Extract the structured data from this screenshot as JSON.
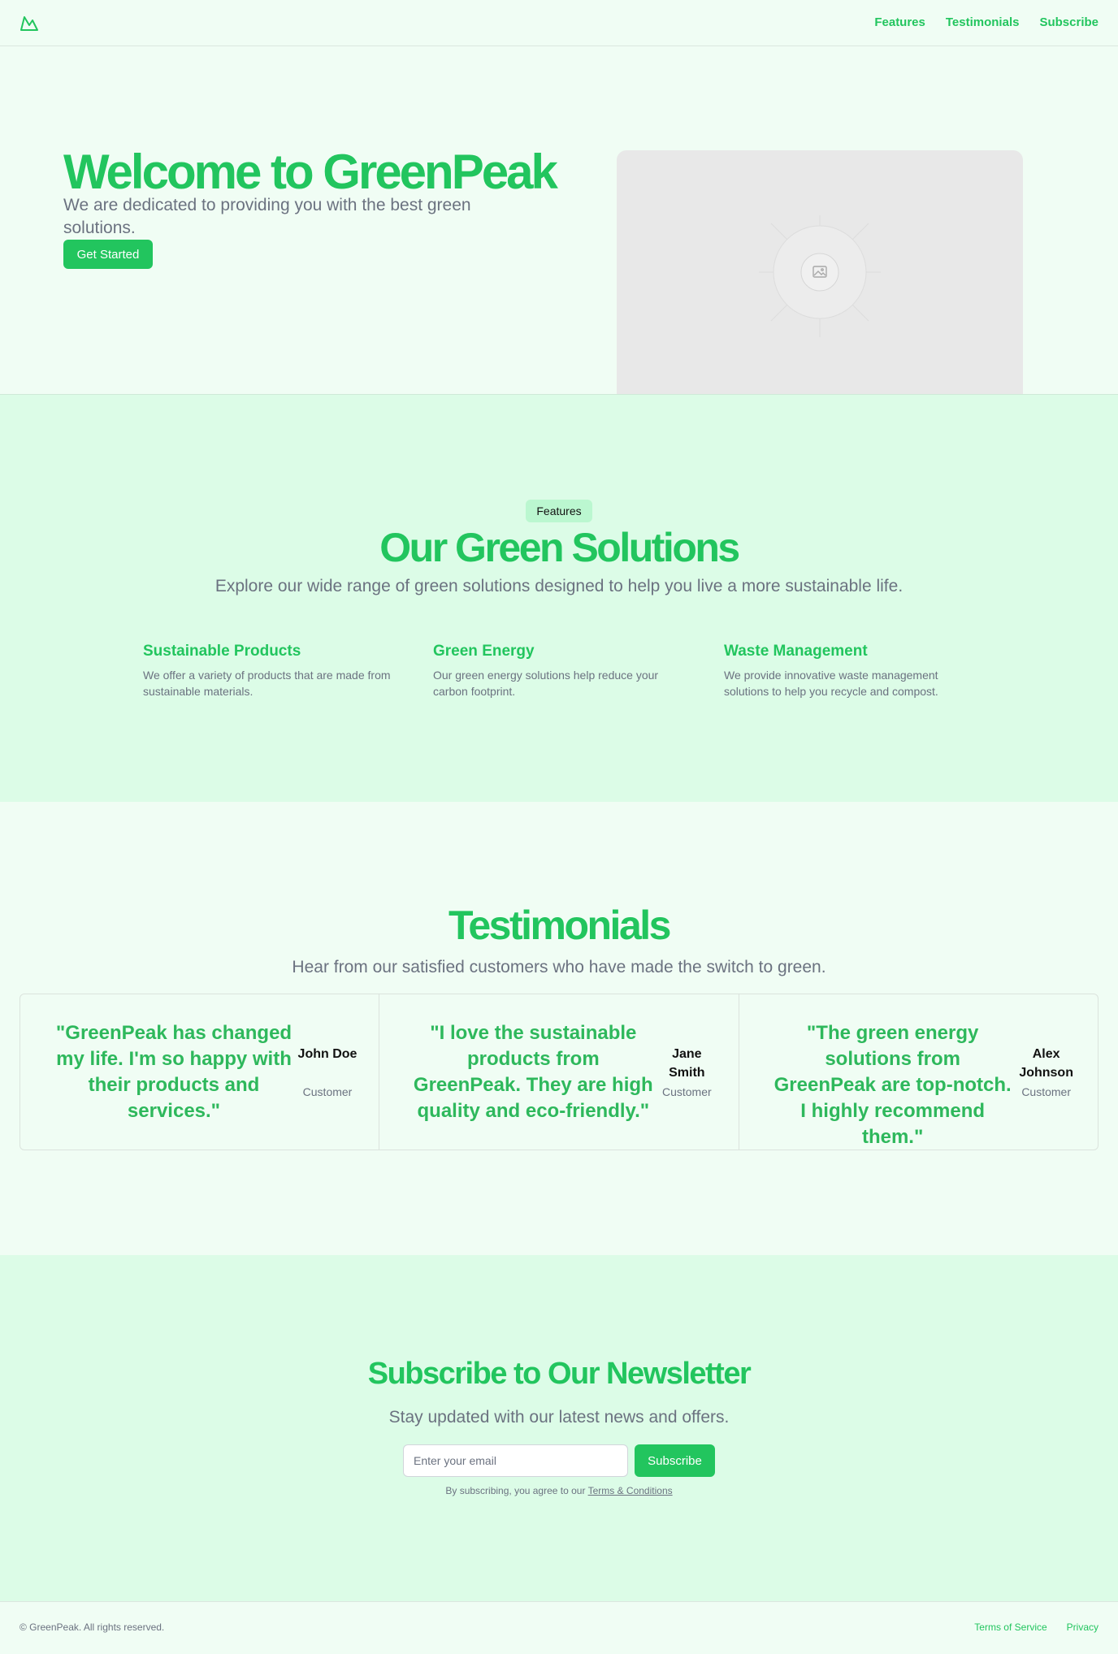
{
  "header": {
    "nav": [
      "Features",
      "Testimonials",
      "Subscribe"
    ]
  },
  "hero": {
    "title": "Welcome to GreenPeak",
    "subtitle": "We are dedicated to providing you with the best green solutions.",
    "cta_label": "Get Started"
  },
  "features": {
    "badge": "Features",
    "title": "Our Green Solutions",
    "subtitle": "Explore our wide range of green solutions designed to help you live a more sustainable life.",
    "items": [
      {
        "title": "Sustainable Products",
        "text": "We offer a variety of products that are made from sustainable materials."
      },
      {
        "title": "Green Energy",
        "text": "Our green energy solutions help reduce your carbon footprint."
      },
      {
        "title": "Waste Management",
        "text": "We provide innovative waste management solutions to help you recycle and compost."
      }
    ]
  },
  "testimonials": {
    "title": "Testimonials",
    "subtitle": "Hear from our satisfied customers who have made the switch to green.",
    "items": [
      {
        "quote": "\"GreenPeak has changed my life. I'm so happy with their products and services.\"",
        "name": "John Doe",
        "role": "Customer"
      },
      {
        "quote": "\"I love the sustainable products from GreenPeak. They are high quality and eco-friendly.\"",
        "name": "Jane Smith",
        "role": "Customer"
      },
      {
        "quote": "\"The green energy solutions from GreenPeak are top-notch. I highly recommend them.\"",
        "name": "Alex Johnson",
        "role": "Customer"
      }
    ]
  },
  "newsletter": {
    "title": "Subscribe to Our Newsletter",
    "subtitle": "Stay updated with our latest news and offers.",
    "email_placeholder": "Enter your email",
    "button_label": "Subscribe",
    "terms_prefix": "By subscribing, you agree to our ",
    "terms_link": "Terms & Conditions"
  },
  "footer": {
    "copyright": "© GreenPeak. All rights reserved.",
    "links": [
      "Terms of Service",
      "Privacy"
    ]
  },
  "colors": {
    "accent": "#22c55e",
    "bg_light": "#f0fdf4",
    "bg_green": "#dcfce7"
  }
}
